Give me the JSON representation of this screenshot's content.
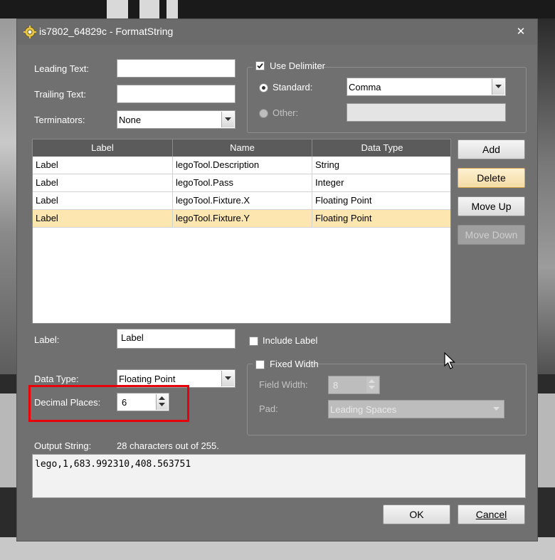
{
  "window": {
    "title": "is7802_64829c - FormatString",
    "close_glyph": "✕"
  },
  "leading_text": {
    "label": "Leading Text:",
    "value": ""
  },
  "trailing_text": {
    "label": "Trailing Text:",
    "value": ""
  },
  "terminators": {
    "label": "Terminators:",
    "value": "None"
  },
  "delimiter": {
    "checkbox_label": "Use Delimiter",
    "checked": true,
    "standard_label": "Standard:",
    "standard_value": "Comma",
    "other_label": "Other:",
    "other_value": ""
  },
  "table": {
    "columns": [
      "Label",
      "Name",
      "Data Type"
    ],
    "rows": [
      {
        "label": "Label",
        "name": "legoTool.Description",
        "data_type": "String",
        "selected": false
      },
      {
        "label": "Label",
        "name": "legoTool.Pass",
        "data_type": "Integer",
        "selected": false
      },
      {
        "label": "Label",
        "name": "legoTool.Fixture.X",
        "data_type": "Floating Point",
        "selected": false
      },
      {
        "label": "Label",
        "name": "legoTool.Fixture.Y",
        "data_type": "Floating Point",
        "selected": true
      }
    ]
  },
  "buttons": {
    "add": "Add",
    "delete": "Delete",
    "move_up": "Move Up",
    "move_down": "Move Down",
    "ok": "OK",
    "cancel": "Cancel"
  },
  "item": {
    "label_label": "Label:",
    "label_value": "Label",
    "include_label": "Include Label",
    "data_type_label": "Data Type:",
    "data_type_value": "Floating Point",
    "decimal_places_label": "Decimal Places:",
    "decimal_places_value": "6"
  },
  "fixed_width": {
    "checkbox_label": "Fixed Width",
    "field_width_label": "Field Width:",
    "field_width_value": "8",
    "pad_label": "Pad:",
    "pad_value": "Leading Spaces"
  },
  "output": {
    "label": "Output String:",
    "count": "28 characters out of 255.",
    "value": "lego,1,683.992310,408.563751"
  },
  "colors": {
    "highlight": "#e8000b",
    "selected_row": "#fde6b0",
    "dialog_bg": "#707070"
  }
}
